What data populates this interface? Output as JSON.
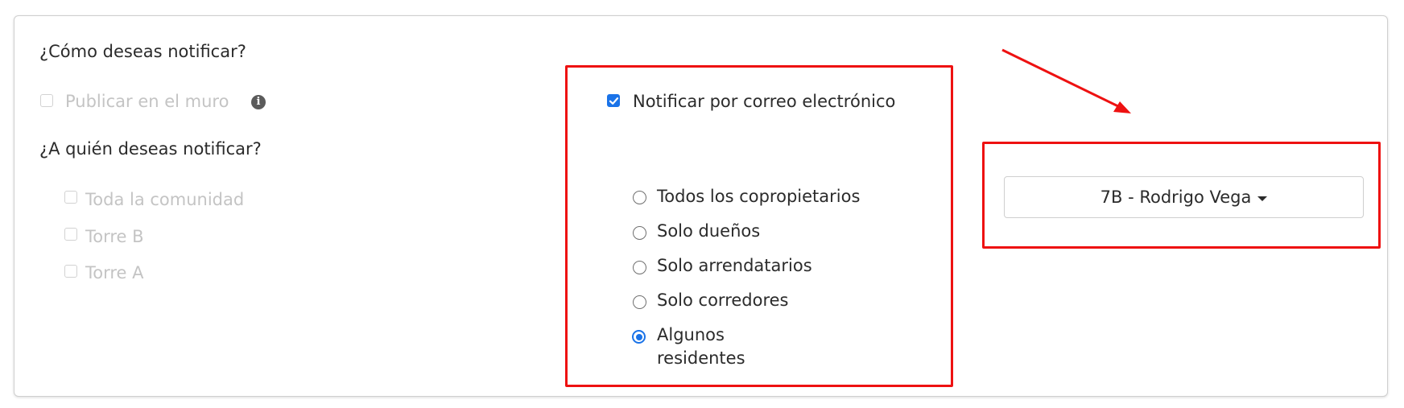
{
  "notify_section": {
    "how_heading": "¿Cómo deseas notificar?",
    "publish_wall": {
      "label": "Publicar en el muro",
      "checked": false,
      "disabled": true,
      "info_icon": "info-circle-icon"
    },
    "email": {
      "label": "Notificar por correo electrónico",
      "checked": true
    }
  },
  "recipients_section": {
    "who_heading": "¿A quién deseas notificar?",
    "groups": [
      {
        "label": "Toda la comunidad",
        "checked": false,
        "disabled": true
      },
      {
        "label": "Torre B",
        "checked": false,
        "disabled": true
      },
      {
        "label": "Torre A",
        "checked": false,
        "disabled": true
      }
    ],
    "radio_options": [
      {
        "label": "Todos los copropietarios",
        "selected": false
      },
      {
        "label": "Solo dueños",
        "selected": false
      },
      {
        "label": "Solo arrendatarios",
        "selected": false
      },
      {
        "label": "Solo corredores",
        "selected": false
      },
      {
        "label": "Algunos residentes",
        "selected": true
      }
    ]
  },
  "resident_select": {
    "selected_value": "7B - Rodrigo Vega",
    "icon": "caret-down-icon"
  },
  "colors": {
    "accent": "#1a73e8",
    "annotation": "#ee1111",
    "disabled_text": "#c4c4c4"
  }
}
